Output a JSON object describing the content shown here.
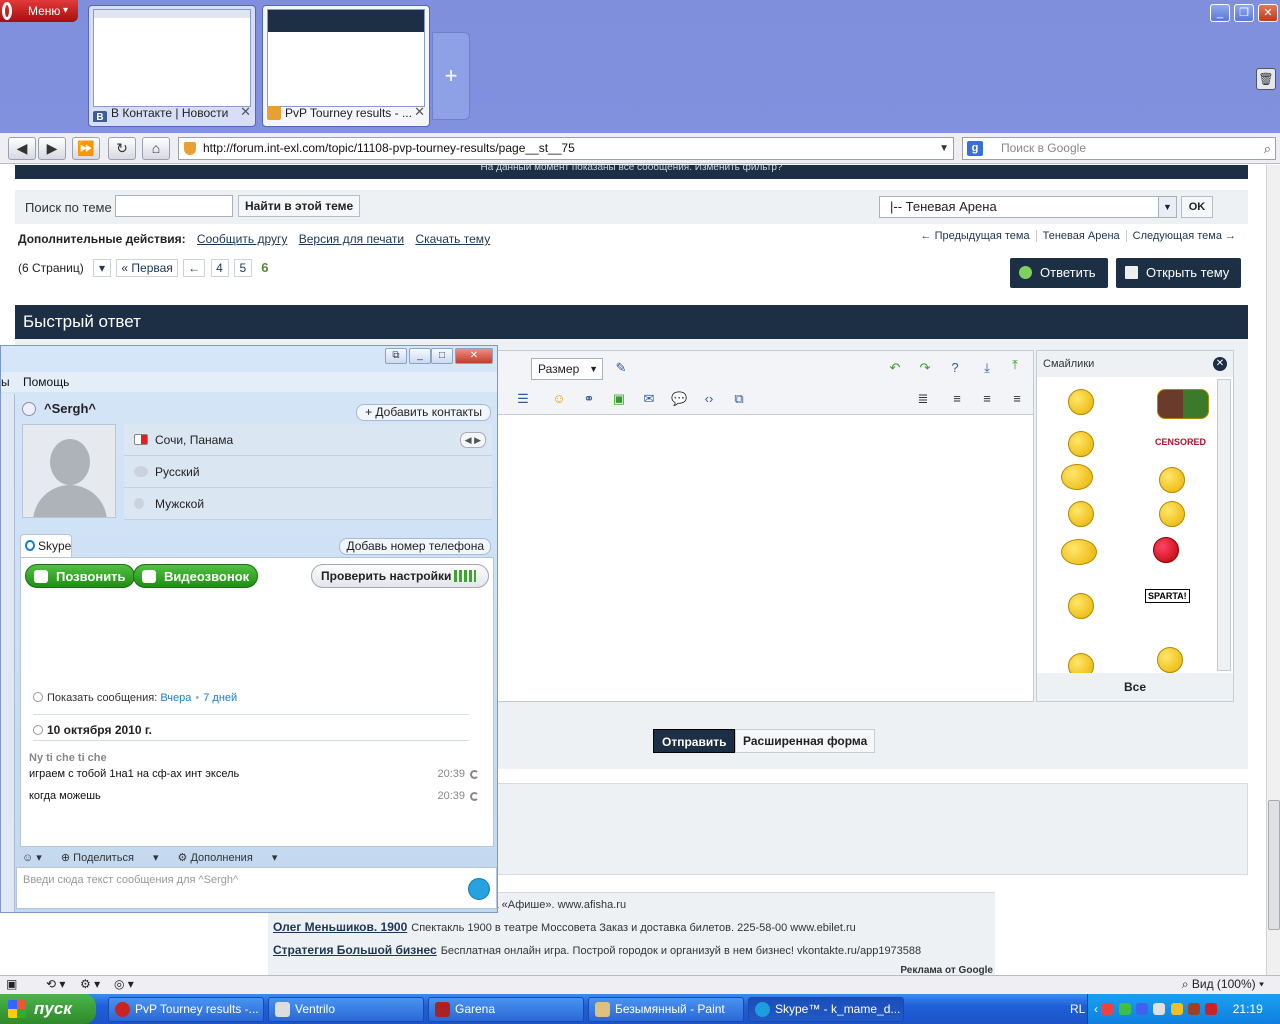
{
  "opera": {
    "menu_label": "Меню",
    "tabs": [
      {
        "title": "В Контакте | Новости",
        "icon_letter": "B"
      },
      {
        "title": "PvP Tourney results - ...",
        "icon_letter": ""
      }
    ],
    "new_tab_symbol": "+"
  },
  "address": {
    "url": "http://forum.int-exl.com/topic/11108-pvp-tourney-results/page__st__75",
    "search_placeholder": "Поиск в Google"
  },
  "forum": {
    "filter_notice": "На данный момент показаны все сообщения. Изменить фильтр?",
    "search_label": "Поиск по теме",
    "search_button": "Найти в этой теме",
    "forum_select": "|-- Теневая Арена",
    "ok_button": "OK",
    "actions_label": "Дополнительные действия:",
    "actions": [
      "Сообщить другу",
      "Версия для печати",
      "Скачать тему"
    ],
    "topic_nav": [
      "← Предыдущая тема",
      "Теневая Арена",
      "Следующая тема →"
    ],
    "pages_label": "(6 Страниц)",
    "first_page": "« Первая",
    "prev_page": "←",
    "page_links": [
      "4",
      "5"
    ],
    "current_page": "6",
    "reply_button": "Ответить",
    "new_topic_button": "Открыть тему",
    "quick_reply_title": "Быстрый ответ",
    "size_select": "Размер",
    "smileys_title": "Смайлики",
    "smileys_all": "Все",
    "smiley_tags": [
      "CENSORED",
      "SPARTA!"
    ],
    "send_button": "Отправить",
    "advanced_form": "Расширенная форма",
    "ads": [
      {
        "title": "",
        "text": "ров Петербурга. Расписание спектаклей на «Афише». www.afisha.ru"
      },
      {
        "title": "Олег Меньшиков. 1900",
        "text": "Спектакль 1900 в театре Моссовета Заказ и доставка билетов. 225-58-00 www.ebilet.ru"
      },
      {
        "title": "Стратегия Большой бизнес",
        "text": "Бесплатная онлайн игра. Построй городок и организуй в нем бизнес! vkontakte.ru/app1973588"
      }
    ],
    "ads_by": "Реклама от Google"
  },
  "skype": {
    "menu_partial": "ы",
    "menu_help": "Помощь",
    "contact_name": "^Sergh^",
    "add_contacts": "+ Добавить контакты",
    "info": [
      {
        "text": "Сочи, Панама",
        "icon": "flag-icon"
      },
      {
        "text": "Русский",
        "icon": "language-icon"
      },
      {
        "text": "Мужской",
        "icon": "gender-icon"
      }
    ],
    "tab_label": "Skype",
    "add_phone": "Добавь номер телефона",
    "call_button": "Позвонить",
    "video_button": "Видеозвонок",
    "check_settings": "Проверить настройки",
    "show_messages": "Показать сообщения:",
    "yesterday": "Вчера",
    "seven_days": "7 дней",
    "date_header": "10 октября 2010 г.",
    "author": "Ny ti che ti che",
    "messages": [
      {
        "text": "играем с тобой 1на1 на сф-ах инт эксель",
        "time": "20:39"
      },
      {
        "text": "когда можешь",
        "time": "20:39"
      }
    ],
    "toolbar": [
      "Поделиться",
      "Дополнения"
    ],
    "input_placeholder": "Введи сюда текст сообщения для ^Sergh^"
  },
  "status": {
    "zoom": "Вид (100%)"
  },
  "taskbar": {
    "start": "пуск",
    "windows": [
      {
        "label": "PvP Tourney results -...",
        "color": "#cc2222"
      },
      {
        "label": "Ventrilo",
        "color": "#dddddd"
      },
      {
        "label": "Garena",
        "color": "#aa2222"
      },
      {
        "label": "Безымянный - Paint",
        "color": "#e0c080"
      },
      {
        "label": "Skype™ - k_mame_d...",
        "color": "#1a9ee0"
      }
    ],
    "lang": "RL",
    "clock": "21:19"
  }
}
